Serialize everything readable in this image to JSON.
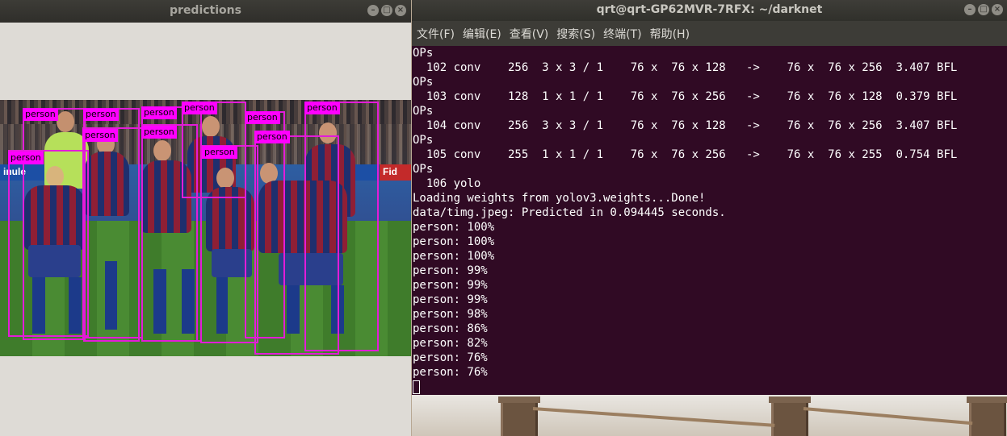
{
  "predictions_window": {
    "title": "predictions",
    "controls": [
      "–",
      "□",
      "×"
    ],
    "banner_text": "Fid",
    "banner_text_left": "inule",
    "detections": [
      {
        "label": "person"
      },
      {
        "label": "person"
      },
      {
        "label": "person"
      },
      {
        "label": "person"
      },
      {
        "label": "person"
      },
      {
        "label": "person"
      },
      {
        "label": "person"
      },
      {
        "label": "person"
      },
      {
        "label": "person"
      },
      {
        "label": "person"
      },
      {
        "label": "person"
      }
    ]
  },
  "terminal_window": {
    "title": "qrt@qrt-GP62MVR-7RFX: ~/darknet",
    "controls": [
      "–",
      "□",
      "×"
    ],
    "menu": [
      "文件(F)",
      "编辑(E)",
      "查看(V)",
      "搜索(S)",
      "终端(T)",
      "帮助(H)"
    ],
    "lines": [
      "OPs",
      "  102 conv    256  3 x 3 / 1    76 x  76 x 128   ->    76 x  76 x 256  3.407 BFL",
      "OPs",
      "  103 conv    128  1 x 1 / 1    76 x  76 x 256   ->    76 x  76 x 128  0.379 BFL",
      "OPs",
      "  104 conv    256  3 x 3 / 1    76 x  76 x 128   ->    76 x  76 x 256  3.407 BFL",
      "OPs",
      "  105 conv    255  1 x 1 / 1    76 x  76 x 256   ->    76 x  76 x 255  0.754 BFL",
      "OPs",
      "  106 yolo",
      "Loading weights from yolov3.weights...Done!",
      "data/timg.jpeg: Predicted in 0.094445 seconds.",
      "person: 100%",
      "person: 100%",
      "person: 100%",
      "person: 99%",
      "person: 99%",
      "person: 99%",
      "person: 98%",
      "person: 86%",
      "person: 82%",
      "person: 76%",
      "person: 76%"
    ]
  },
  "colors": {
    "terminal_bg": "#300a24",
    "bbox": "#e31cd8",
    "label_bg": "#ff00ff"
  }
}
